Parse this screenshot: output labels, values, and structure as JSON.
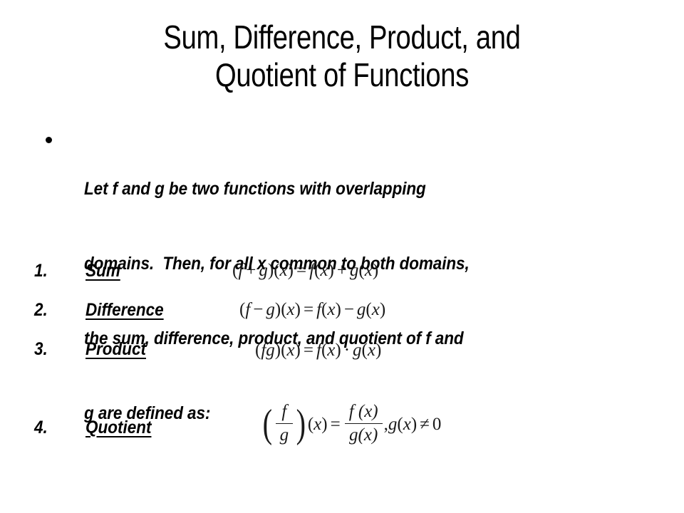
{
  "slide": {
    "background_color": "#ffffff",
    "text_color": "#000000",
    "title": {
      "line1": "Sum, Difference, Product, and",
      "line2": "Quotient of Functions"
    },
    "body": {
      "bullet_glyph": "bullet-dot",
      "lines": [
        "Let f and g be two functions with overlapping",
        "domains.  Then, for all x common to both domains,",
        "the sum, difference, product, and quotient of f and",
        "g are defined as:"
      ],
      "full_text": "Let f and g be two functions with overlapping domains.  Then, for all x common to both domains, the sum, difference, product, and quotient of f and g are defined as:"
    },
    "list": {
      "items": [
        {
          "index": "1.",
          "label": "Sum",
          "equation_text": "(f + g)(x) = f(x) + g(x)",
          "eq": {
            "lhs_open": "(",
            "lhs_f": "f",
            "lhs_op": "+",
            "lhs_g": "g",
            "lhs_close": ")(",
            "lhs_x": "x",
            "lhs_end": ")",
            "equals": "=",
            "rhs_f": "f",
            "rhs_fx_open": "(",
            "rhs_fx": "x",
            "rhs_fx_close": ")",
            "rhs_op": "+",
            "rhs_g": "g",
            "rhs_gx_open": "(",
            "rhs_gx": "x",
            "rhs_gx_close": ")"
          }
        },
        {
          "index": "2.",
          "label": "Difference",
          "equation_text": "(f − g)(x) = f(x) − g(x)",
          "eq": {
            "lhs_open": "(",
            "lhs_f": "f",
            "lhs_op": "−",
            "lhs_g": "g",
            "lhs_close": ")(",
            "lhs_x": "x",
            "lhs_end": ")",
            "equals": "=",
            "rhs_f": "f",
            "rhs_fx_open": "(",
            "rhs_fx": "x",
            "rhs_fx_close": ")",
            "rhs_op": "−",
            "rhs_g": "g",
            "rhs_gx_open": "(",
            "rhs_gx": "x",
            "rhs_gx_close": ")"
          }
        },
        {
          "index": "3.",
          "label": "Product",
          "equation_text": "(fg)(x) = f(x) · g(x)",
          "eq": {
            "lhs_open": "(",
            "lhs_f": "f",
            "lhs_op": "",
            "lhs_g": "g",
            "lhs_close": ")(",
            "lhs_x": "x",
            "lhs_end": ")",
            "equals": "=",
            "rhs_f": "f",
            "rhs_fx_open": "(",
            "rhs_fx": "x",
            "rhs_fx_close": ")",
            "rhs_op": "·",
            "rhs_g": "g",
            "rhs_gx_open": "(",
            "rhs_gx": "x",
            "rhs_gx_close": ")"
          }
        },
        {
          "index": "4.",
          "label": "Quotient",
          "equation_text": "(f/g)(x) = f(x)/g(x), g(x) ≠ 0",
          "eq": {
            "paren_open": "(",
            "frac_num": "f",
            "frac_den": "g",
            "paren_close": ")",
            "of_open": "(",
            "of_x": "x",
            "of_close": ")",
            "equals": "=",
            "rhs_num": "f (x)",
            "rhs_den": "g(x)",
            "comma": ",",
            "cond_g": "g",
            "cond_open": "(",
            "cond_x": "x",
            "cond_close": ")",
            "cond_neq": "≠",
            "cond_zero": "0"
          }
        }
      ]
    }
  }
}
